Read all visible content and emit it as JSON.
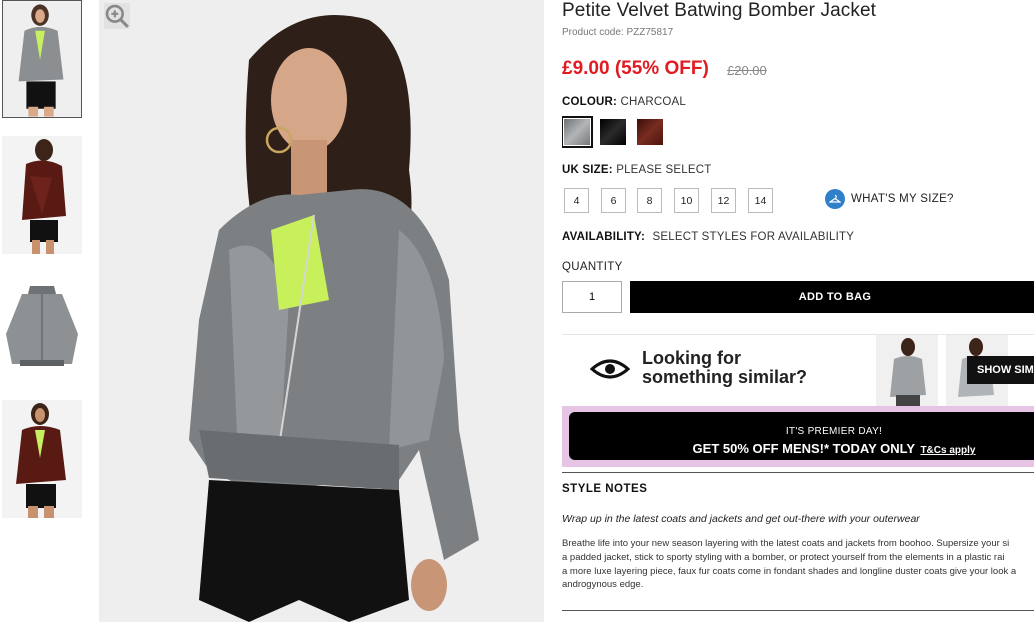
{
  "product": {
    "title": "Petite Velvet Batwing Bomber Jacket",
    "code": "Product code: PZZ75817",
    "price": "£9.00 (55% OFF)",
    "old_price": "£20.00"
  },
  "colour": {
    "label": "COLOUR:",
    "selected": "CHARCOAL",
    "swatches": [
      {
        "name": "charcoal",
        "color": "#8a8d8f"
      },
      {
        "name": "black",
        "color": "#0c0c0c"
      },
      {
        "name": "burgundy",
        "color": "#5a1a14"
      }
    ]
  },
  "size": {
    "label": "UK SIZE:",
    "prompt": "PLEASE SELECT",
    "options": [
      "4",
      "6",
      "8",
      "10",
      "12",
      "14"
    ],
    "help": "WHAT'S MY SIZE?"
  },
  "availability": {
    "label": "AVAILABILITY:",
    "value": "SELECT STYLES FOR AVAILABILITY"
  },
  "quantity": {
    "label": "QUANTITY",
    "value": "1"
  },
  "add_to_bag": "ADD TO BAG",
  "similar": {
    "line1": "Looking for",
    "line2": "something similar?",
    "button": "SHOW SIM"
  },
  "promo": {
    "line1": "IT'S PREMIER DAY!",
    "line2": "GET 50% OFF MENS!* TODAY ONLY",
    "tc": "T&Cs apply"
  },
  "style_notes": {
    "title": "STYLE NOTES",
    "lead": "Wrap up in the latest coats and jackets and get out-there with your outerwear",
    "body": [
      "Breathe life into your new season layering with the latest coats and jackets from boohoo. Supersize your si",
      "a padded jacket, stick to sporty styling with a bomber, or protect yourself from the elements in a plastic rai",
      "a more luxe layering piece, faux fur coats come in fondant shades and longline duster coats give your look a",
      "androgynous edge."
    ]
  },
  "colors": {
    "sale_red": "#e11b22",
    "promo_border": "#e6c4e6",
    "help_blue": "#2f80c9"
  }
}
